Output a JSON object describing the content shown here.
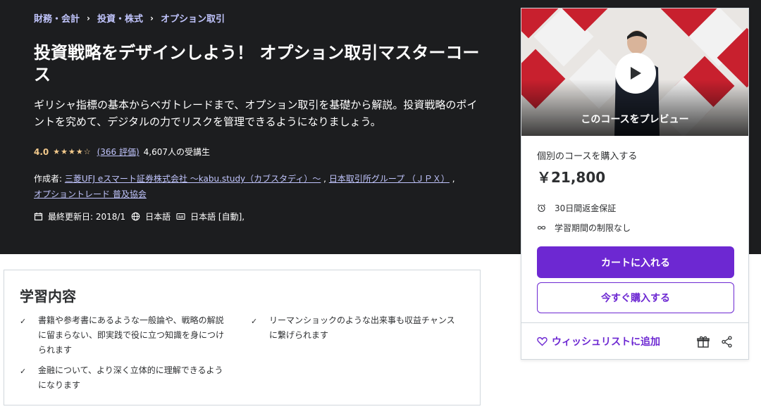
{
  "breadcrumb": [
    "財務・会計",
    "投資・株式",
    "オプション取引"
  ],
  "course": {
    "title": "投資戦略をデザインしよう！ オプション取引マスターコース",
    "subtitle": "ギリシャ指標の基本からベガトレードまで、オプション取引を基礎から解説。投資戦略のポイントを究めて、デジタルの力でリスクを管理できるようになりましょう。",
    "rating": "4.0",
    "rating_count": "(366 評価)",
    "students": "4,607人の受講生",
    "creator_label": "作成者:",
    "creators": [
      "三菱UFJ eスマート証券株式会社 ～kabu.study（カブスタディ）～",
      "日本取引所グループ （ＪＰＸ）",
      "オプショントレード 普及協会"
    ],
    "creator_sep": ",",
    "last_updated": "最終更新日: 2018/1",
    "language": "日本語",
    "captions": "日本語 [自動],"
  },
  "card": {
    "preview_label": "このコースをプレビュー",
    "purchase_label": "個別のコースを購入する",
    "price": "￥21,800",
    "features": [
      "30日間返金保証",
      "学習期間の制限なし"
    ],
    "cart_button": "カートに入れる",
    "buy_button": "今すぐ購入する",
    "wishlist": "ウィッシュリストに追加"
  },
  "learn": {
    "title": "学習内容",
    "items": [
      "書籍や参考書にあるような一般論や、戦略の解説に留まらない、即実践で役に立つ知識を身につけられます",
      "リーマンショックのような出来事も収益チャンスに繋げられます",
      "金融について、より深く立体的に理解できるようになります"
    ]
  },
  "colors": {
    "hero_bg": "#1c1d1f",
    "accent": "#6d28d2",
    "link": "#c0c4fc",
    "star": "#f3ca8c"
  },
  "icons": [
    "calendar-icon",
    "globe-icon",
    "captions-icon",
    "alarm-icon",
    "infinity-icon",
    "play-icon",
    "heart-icon",
    "gift-icon",
    "share-icon",
    "check-icon",
    "chevron-right-icon"
  ]
}
